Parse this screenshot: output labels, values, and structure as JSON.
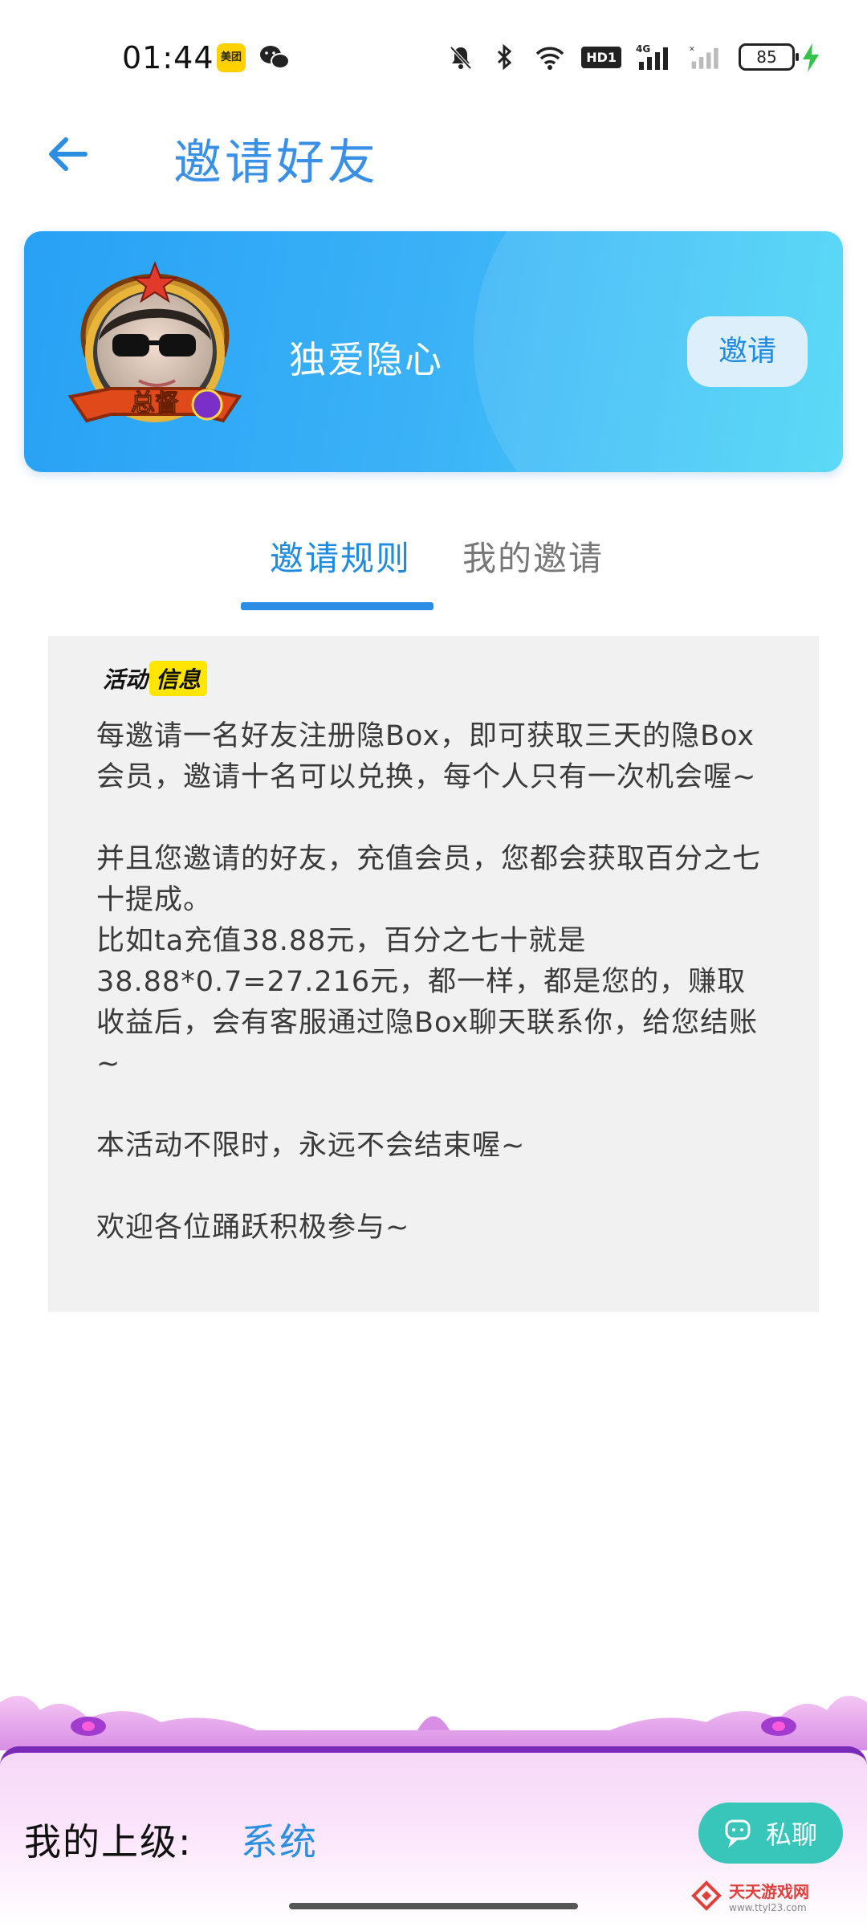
{
  "status_bar": {
    "time": "01:44",
    "meituan_label": "美团",
    "hd_label": "HD1",
    "network_label": "4G",
    "battery": "85"
  },
  "header": {
    "title": "邀请好友"
  },
  "profile": {
    "name": "独爱隐心",
    "invite_label": "邀请",
    "badge_text": "总督"
  },
  "tabs": [
    {
      "label": "邀请规则",
      "active": true
    },
    {
      "label": "我的邀请",
      "active": false
    }
  ],
  "activity": {
    "tag_part1": "活动",
    "tag_part2": "信息",
    "paragraphs": [
      "每邀请一名好友注册隐Box，即可获取三天的隐Box会员，邀请十名可以兑换，每个人只有一次机会喔~",
      "并且您邀请的好友，充值会员，您都会获取百分之七十提成。",
      "比如ta充值38.88元，百分之七十就是38.88*0.7=27.216元，都一样，都是您的，赚取收益后，会有客服通过隐Box聊天联系你，给您结账~",
      "本活动不限时，永远不会结束喔~",
      "欢迎各位踊跃积极参与~"
    ]
  },
  "bottom": {
    "superior_label": "我的上级:",
    "superior_value": "系统",
    "chat_label": "私聊"
  },
  "watermark": {
    "title": "天天游戏网",
    "url": "www.ttyl23.com"
  },
  "colors": {
    "accent": "#2b8de4",
    "card_start": "#27a1f5",
    "card_end": "#4ad6f5",
    "chat_button": "#37c6b9",
    "bottom_border": "#7a2bb8"
  }
}
